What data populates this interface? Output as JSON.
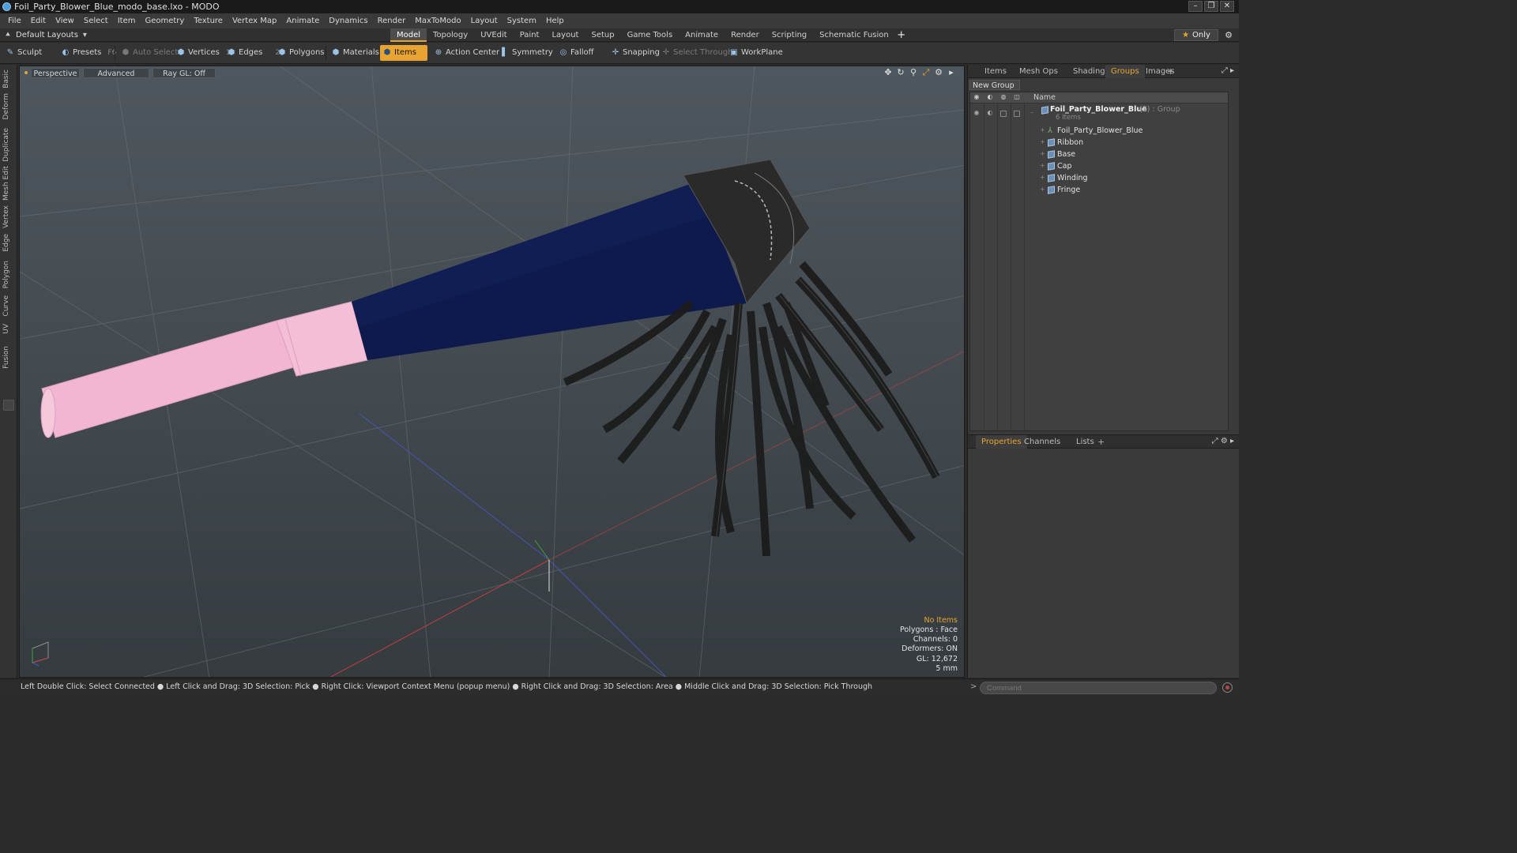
{
  "window": {
    "title": "Foil_Party_Blower_Blue_modo_base.lxo - MODO",
    "buttons": [
      "–",
      "❐",
      "✕"
    ]
  },
  "menu": [
    "File",
    "Edit",
    "View",
    "Select",
    "Item",
    "Geometry",
    "Texture",
    "Vertex Map",
    "Animate",
    "Dynamics",
    "Render",
    "MaxToModo",
    "Layout",
    "System",
    "Help"
  ],
  "layouts": {
    "dropdown": "Default Layouts",
    "tabs": [
      "Model",
      "Topology",
      "UVEdit",
      "Paint",
      "Layout",
      "Setup",
      "Game Tools",
      "Animate",
      "Render",
      "Scripting",
      "Schematic Fusion"
    ],
    "active_tab": "Model",
    "only_label": "Only"
  },
  "toolbar": {
    "sculpt": "Sculpt",
    "presets": "Presets",
    "presets_key": "F6",
    "auto_select": "Auto Select",
    "vertices": "Vertices",
    "vertices_count": "1",
    "edges": "Edges",
    "edges_count": "2",
    "polygons": "Polygons",
    "materials": "Materials",
    "items": "Items",
    "action_center": "Action Center",
    "symmetry": "Symmetry",
    "falloff": "Falloff",
    "snapping": "Snapping",
    "select_through": "Select Through",
    "workplane": "WorkPlane"
  },
  "left_tabs": [
    "Basic",
    "Deform",
    "Duplicate",
    "Mesh Edit",
    "Vertex",
    "Edge",
    "Polygon",
    "Curve",
    "UV",
    "Fusion"
  ],
  "viewport": {
    "view": "Perspective",
    "shading": "Advanced",
    "raygl": "Ray GL: Off",
    "info": {
      "selection": "No Items",
      "polygons": "Polygons : Face",
      "channels": "Channels: 0",
      "deformers": "Deformers: ON",
      "gl": "GL: 12,672",
      "unit": "5 mm"
    }
  },
  "groups_panel": {
    "tabs": [
      "Items",
      "Mesh Ops",
      "Shading",
      "Groups",
      "Images"
    ],
    "active_tab": "Groups",
    "new_group": "New Group",
    "name_header": "Name",
    "group": {
      "name": "Foil_Party_Blower_Blue",
      "count": "(2)",
      "type": ": Group",
      "items_label": "6 Items"
    },
    "items": [
      "Foil_Party_Blower_Blue",
      "Ribbon",
      "Base",
      "Cap",
      "Winding",
      "Fringe"
    ]
  },
  "properties_panel": {
    "tabs": [
      "Properties",
      "Channels",
      "Lists"
    ],
    "active_tab": "Properties"
  },
  "status": {
    "hint": "Left Double Click: Select Connected ● Left Click and Drag: 3D Selection: Pick ● Right Click: Viewport Context Menu (popup menu) ● Right Click and Drag: 3D Selection: Area ● Middle Click and Drag: 3D Selection: Pick Through",
    "command_placeholder": "Command"
  },
  "colors": {
    "accent": "#e8a431",
    "selection_blue": "#4aa3df",
    "cone": "#0d1a4a",
    "pink": "#f2b6d2"
  }
}
